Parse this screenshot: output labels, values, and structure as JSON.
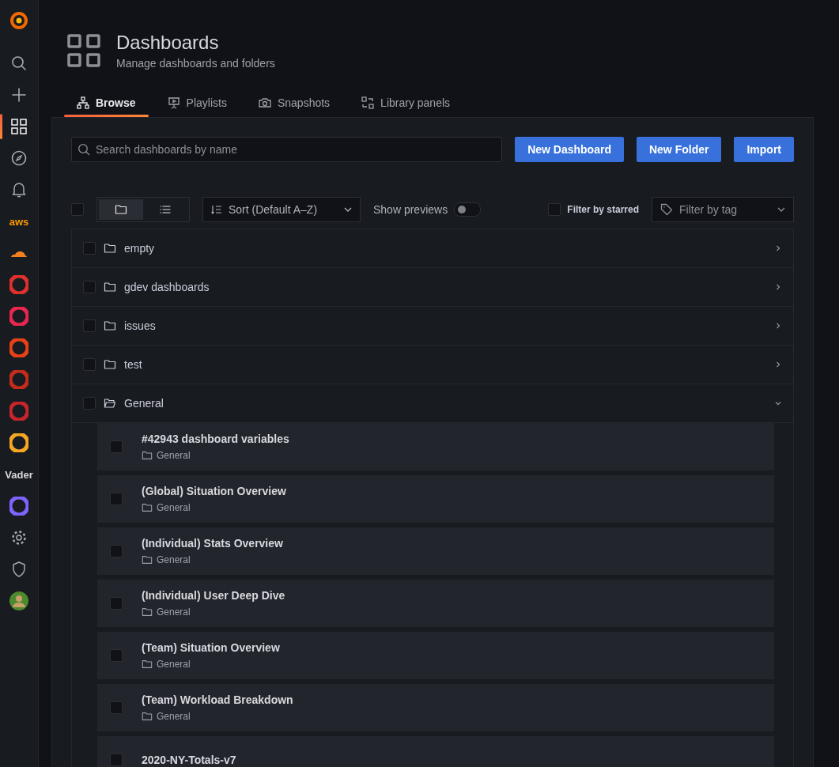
{
  "sidebar": {
    "items": [
      {
        "kind": "logo",
        "selected": false
      },
      {
        "kind": "search",
        "selected": false
      },
      {
        "kind": "plus",
        "selected": false
      },
      {
        "kind": "grid",
        "selected": true
      },
      {
        "kind": "compass",
        "selected": false
      },
      {
        "kind": "bell",
        "selected": false
      },
      {
        "kind": "text",
        "label": "aws",
        "color": "#ff9900",
        "selected": false
      },
      {
        "kind": "cloud",
        "color": "#f38020",
        "selected": false
      },
      {
        "kind": "app",
        "color": "#e02f2f",
        "selected": false
      },
      {
        "kind": "app",
        "color": "#e8264f",
        "selected": false
      },
      {
        "kind": "app",
        "color": "#e8411a",
        "selected": false
      },
      {
        "kind": "app",
        "color": "#c42b1c",
        "selected": false
      },
      {
        "kind": "app",
        "color": "#c8242c",
        "selected": false
      },
      {
        "kind": "app",
        "color": "#f5a623",
        "selected": false
      },
      {
        "kind": "text",
        "label": "Vader",
        "color": "#d8d9da",
        "selected": false
      },
      {
        "kind": "app",
        "color": "#7d64ff",
        "selected": false
      },
      {
        "kind": "gear",
        "selected": false
      },
      {
        "kind": "shield",
        "selected": false
      },
      {
        "kind": "avatar",
        "selected": false
      }
    ]
  },
  "header": {
    "title": "Dashboards",
    "subtitle": "Manage dashboards and folders"
  },
  "tabs": [
    {
      "label": "Browse",
      "selected": true
    },
    {
      "label": "Playlists",
      "selected": false
    },
    {
      "label": "Snapshots",
      "selected": false
    },
    {
      "label": "Library panels",
      "selected": false
    }
  ],
  "search": {
    "placeholder": "Search dashboards by name"
  },
  "actions": [
    "New Dashboard",
    "New Folder",
    "Import"
  ],
  "toolbar": {
    "select_all_checked": false,
    "view_modes": [
      {
        "selected": true
      },
      {
        "selected": false
      }
    ],
    "sort": "Sort (Default A–Z)",
    "show_previews_label": "Show previews",
    "show_previews_on": false,
    "starred_label": "Filter by starred",
    "starred_checked": false,
    "tag_placeholder": "Filter by tag"
  },
  "folders": [
    {
      "name": "empty",
      "expanded": false,
      "checked": false
    },
    {
      "name": "gdev dashboards",
      "expanded": false,
      "checked": false
    },
    {
      "name": "issues",
      "expanded": false,
      "checked": false
    },
    {
      "name": "test",
      "expanded": false,
      "checked": false
    },
    {
      "name": "General",
      "expanded": true,
      "checked": false,
      "dashboards": [
        {
          "title": "#42943 dashboard variables",
          "folder": "General",
          "checked": false
        },
        {
          "title": "(Global) Situation Overview",
          "folder": "General",
          "checked": false
        },
        {
          "title": "(Individual) Stats Overview",
          "folder": "General",
          "checked": false
        },
        {
          "title": "(Individual) User Deep Dive",
          "folder": "General",
          "checked": false
        },
        {
          "title": "(Team) Situation Overview",
          "folder": "General",
          "checked": false
        },
        {
          "title": "(Team) Workload Breakdown",
          "folder": "General",
          "checked": false
        },
        {
          "title": "2020-NY-Totals-v7",
          "checked": false
        }
      ]
    }
  ]
}
